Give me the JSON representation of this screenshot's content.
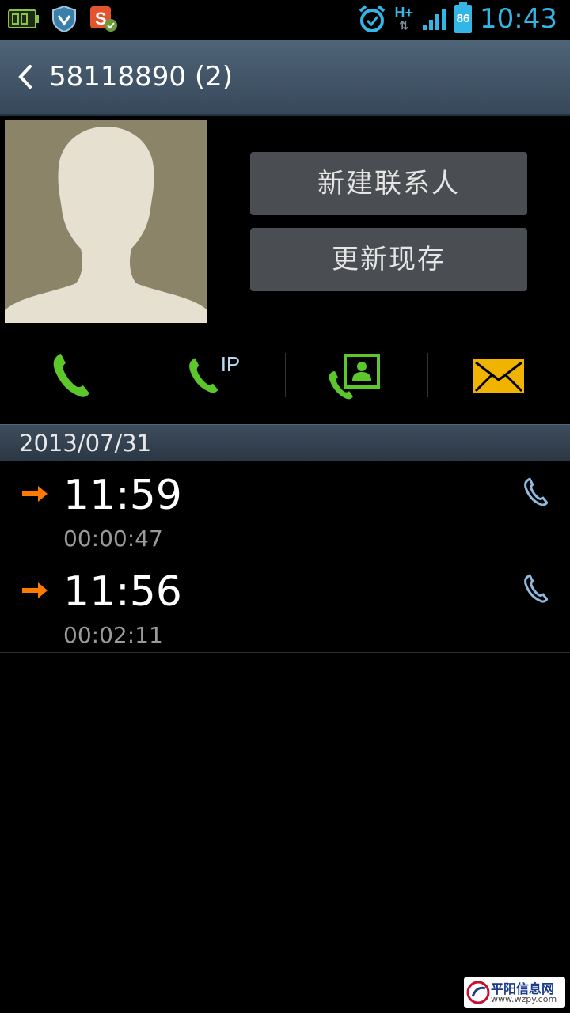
{
  "status_bar": {
    "time": "10:43",
    "battery": "86",
    "network": "H+",
    "icons_left": [
      "battery-indicator-icon",
      "shield-icon",
      "sogou-input-icon"
    ],
    "icons_right": [
      "alarm-icon",
      "network-hplus-icon",
      "signal-icon",
      "battery-icon"
    ]
  },
  "header": {
    "title": "58118890 (2)"
  },
  "contact_buttons": {
    "new_contact": "新建联系人",
    "update_existing": "更新现存"
  },
  "actions": {
    "ip_label": "IP",
    "items": [
      "call-icon",
      "ip-call-icon",
      "contact-card-call-icon",
      "message-icon"
    ]
  },
  "log": {
    "date": "2013/07/31",
    "entries": [
      {
        "time": "11:59",
        "duration": "00:00:47"
      },
      {
        "time": "11:56",
        "duration": "00:02:11"
      }
    ]
  },
  "watermark": {
    "name": "平阳信息网",
    "url": "www.wzpy.com"
  },
  "colors": {
    "accent": "#33b5e5",
    "call_green": "#5cc62b",
    "outgoing_orange": "#ff7a00",
    "message_yellow": "#f0b400"
  }
}
